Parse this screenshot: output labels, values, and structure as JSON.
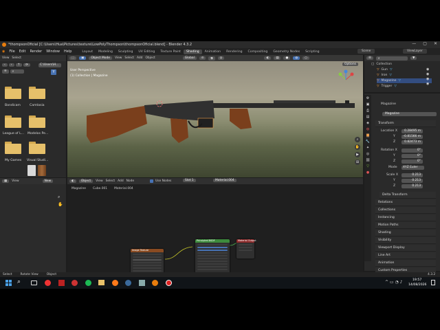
{
  "window": {
    "title": "*thompsonOficial [C:\\Users\\Hua\\Pictures\\texture\\LowPolyThompson\\thompsonOficial.blend] - Blender 4.3.2"
  },
  "menubar": {
    "items": [
      "File",
      "Edit",
      "Render",
      "Window",
      "Help"
    ],
    "workspaces": [
      "Layout",
      "Modeling",
      "Sculpting",
      "UV Editing",
      "Texture Paint",
      "Shading",
      "Animation",
      "Rendering",
      "Compositing",
      "Geometry Nodes",
      "Scripting"
    ],
    "active_workspace": "Shading",
    "scene_label": "Scene",
    "viewlayer_label": "ViewLayer"
  },
  "file_browser": {
    "view_label": "View",
    "select_label": "Select",
    "path_value": "C:\\Users\\H...",
    "folders": [
      "Bandicam",
      "Camtasia",
      "League of L...",
      "Modelos Pe...",
      "My Games",
      "Visual Studi..."
    ]
  },
  "viewport": {
    "mode": "Object Mode",
    "menus": [
      "View",
      "Select",
      "Add",
      "Object"
    ],
    "orientation": "Global",
    "options_label": "Options",
    "perspective_label": "User Perspective",
    "collection_label": "(1) Collection | Magazine"
  },
  "image_editor": {
    "view_label": "View",
    "new_label": "New"
  },
  "node_editor": {
    "object_label": "Object",
    "menus": [
      "View",
      "Select",
      "Add",
      "Node"
    ],
    "use_nodes_label": "Use Nodes",
    "slot_label": "Slot 1",
    "material_label": "Material.004",
    "breadcrumb": [
      "Magazine",
      "Cube.001",
      "Material.004"
    ],
    "node_texture_title": "Image Texture",
    "node_bsdf_title": "Principled BSDF",
    "node_output_title": "Material Output"
  },
  "outliner": {
    "root": "Collection",
    "items": [
      "Gun",
      "Iron",
      "Magazine",
      "Trigger"
    ]
  },
  "properties": {
    "object_name": "Magazine",
    "object_name_field": "Magazine",
    "transform_title": "Transform",
    "location_label": "Location X",
    "location": [
      "0.28495 m",
      "-0.81566 m",
      "0.82473 m"
    ],
    "rotation_label": "Rotation X",
    "rotation": [
      "0°",
      "0°",
      "0°"
    ],
    "mode_label": "Mode",
    "mode_value": "XYZ Euler",
    "scale_label": "Scale X",
    "scale": [
      "0.213",
      "0.213",
      "0.213"
    ],
    "delta_label": "Delta Transform",
    "sections": [
      "Relations",
      "Collections",
      "Instancing",
      "Motion Paths",
      "Shading",
      "Visibility",
      "Viewport Display",
      "Line Art",
      "Animation",
      "Custom Properties"
    ]
  },
  "statusbar": {
    "items": [
      "Select",
      "Rotate View",
      "Object"
    ],
    "version": "4.3.2"
  },
  "taskbar": {
    "time": "19:57",
    "date": "14/08/2026"
  },
  "colors": {
    "accent": "#4772b3",
    "active_object": "#f0a04a",
    "folder": "#e6c06a",
    "gun_wood": "#7a3f1c",
    "gun_metal": "#2a2a2a"
  }
}
